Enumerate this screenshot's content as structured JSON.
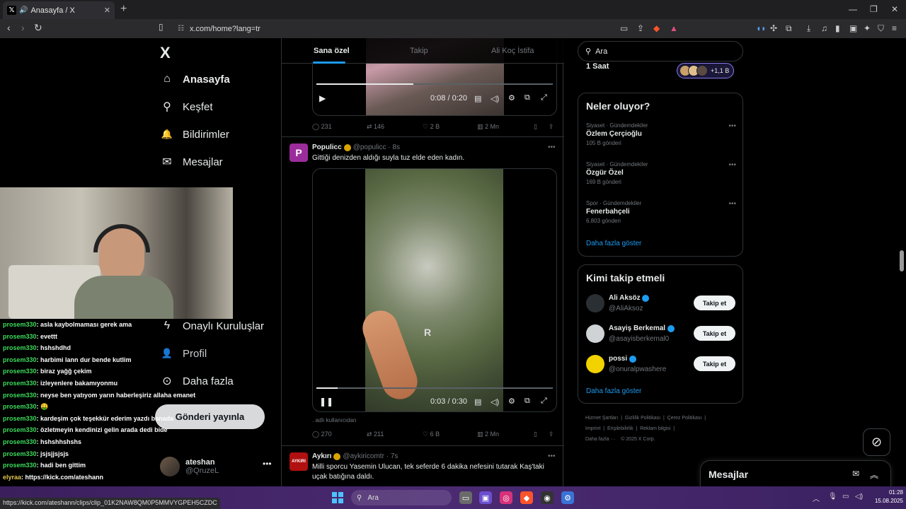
{
  "browser": {
    "tab_title": "Anasayfa / X",
    "tab_close": "✕",
    "new_tab": "+",
    "url": "x.com/home?lang=tr",
    "window_controls": [
      "—",
      "❐",
      "✕"
    ]
  },
  "nav": {
    "logo": "X",
    "items": [
      {
        "label": "Anasayfa",
        "icon": "home-icon",
        "glyph": "⌂"
      },
      {
        "label": "Keşfet",
        "icon": "search-icon",
        "glyph": "⚲"
      },
      {
        "label": "Bildirimler",
        "icon": "bell-icon",
        "glyph": "🔔"
      },
      {
        "label": "Mesajlar",
        "icon": "mail-icon",
        "glyph": "✉"
      },
      {
        "label": "Onaylı Kuruluşlar",
        "icon": "lightning-icon",
        "glyph": "ϟ"
      },
      {
        "label": "Profil",
        "icon": "person-icon",
        "glyph": "👤"
      },
      {
        "label": "Daha fazla",
        "icon": "more-circle-icon",
        "glyph": "⊙"
      }
    ],
    "post_button": "Gönderi yayınla",
    "account": {
      "name": "ateshan",
      "handle": "@QruzeL",
      "more": "•••"
    }
  },
  "feed": {
    "tabs": [
      "Sana özel",
      "Takip",
      "Ali Koç İstifa"
    ],
    "video1": {
      "time": "0:08 / 0:20",
      "progress": 0.41
    },
    "stats1": {
      "replies": "231",
      "reposts": "146",
      "likes": "2 B",
      "views": "2 Mn"
    },
    "tweet2": {
      "name": "Populicc",
      "handle": "@populicc",
      "time": "8s",
      "text": "Gittiği denizden aldığı suyla tuz elde eden kadın.",
      "video_time": "0:03 / 0:30",
      "progress": 0.09,
      "watermark": "R",
      "attribution": ". adlı kullanıcıdan",
      "stats": {
        "replies": "270",
        "reposts": "211",
        "likes": "6 B",
        "views": "2 Mn"
      }
    },
    "tweet3": {
      "name": "Aykırı",
      "handle": "@aykiricomtr",
      "time": "7s",
      "avatar_text": "AYKIRI",
      "text": "Milli sporcu Yasemin Ulucan, tek seferde 6 dakika nefesini tutarak Kaş'taki uçak batığına daldı."
    },
    "more": "•••"
  },
  "right": {
    "search_placeholder": "Ara",
    "space": {
      "label": "1 Saat",
      "count": "+1,1 B"
    },
    "trends_title": "Neler oluyor?",
    "trends": [
      {
        "category": "Siyaset · Gündemdekiler",
        "name": "Özlem Çerçioğlu",
        "count": "105 B gönderi"
      },
      {
        "category": "Siyaset · Gündemdekiler",
        "name": "Özgür Özel",
        "count": "169 B gönderi"
      },
      {
        "category": "Spor · Gündemdekiler",
        "name": "Fenerbahçeli",
        "count": "6.803 gönderi"
      }
    ],
    "trends_more": "Daha fazla göster",
    "who_title": "Kimi takip etmeli",
    "who": [
      {
        "name": "Ali Aksöz",
        "handle": "@AliAksoz",
        "button": "Takip et"
      },
      {
        "name": "Asayiş Berkemal",
        "handle": "@asayisberkemal0",
        "button": "Takip et"
      },
      {
        "name": "possi",
        "handle": "@onuralpwashere",
        "button": "Takip et"
      }
    ],
    "who_more": "Daha fazla göster",
    "footer": [
      "Hizmet Şartları",
      "Gizlilik Politikası",
      "Çerez Politikası",
      "Imprint",
      "Erişilebilirlik",
      "Reklam bilgisi",
      "Daha fazla ···",
      "© 2025 X Corp."
    ],
    "messages_title": "Mesajlar"
  },
  "chat": {
    "lines": [
      {
        "user": "prosem330",
        "text": ": asla kaybolmaması gerek ama"
      },
      {
        "user": "prosem330",
        "text": ": evettt"
      },
      {
        "user": "prosem330",
        "text": ": hshshdhd"
      },
      {
        "user": "prosem330",
        "text": ": harbimi lann dur bende kutlim"
      },
      {
        "user": "prosem330",
        "text": ": biraz yağğ çekim"
      },
      {
        "user": "prosem330",
        "text": ": izleyenlere bakamıyonmu"
      },
      {
        "user": "prosem330",
        "text": ": neyse ben yatıyom yarın haberleşiriz allaha emanet"
      },
      {
        "user": "prosem330",
        "text": ": 🤑"
      },
      {
        "user": "prosem330",
        "text": ": kardeşim çok teşekkür ederim yazdı banada"
      },
      {
        "user": "prosem330",
        "text": ": özletmeyin kendinizi gelin arada dedi bide"
      },
      {
        "user": "prosem330",
        "text": ": hshshhshshs"
      },
      {
        "user": "prosem330",
        "text": ": jsjsjjsjsjs"
      },
      {
        "user": "prosem330",
        "text": ": hadi ben gittim"
      },
      {
        "user": "elyraa",
        "text": ": https://kick.com/ateshann"
      }
    ]
  },
  "status_url": "https://kick.com/ateshann/clips/clip_01K2NAW8QM0P5MMVYGPEH5CZDC",
  "taskbar": {
    "search": "Ara",
    "time": "01:28",
    "date": "15.08.2025"
  },
  "colors": {
    "accent": "#1d9bf0",
    "chat_user": "#3cdc5c",
    "background": "#000000"
  }
}
